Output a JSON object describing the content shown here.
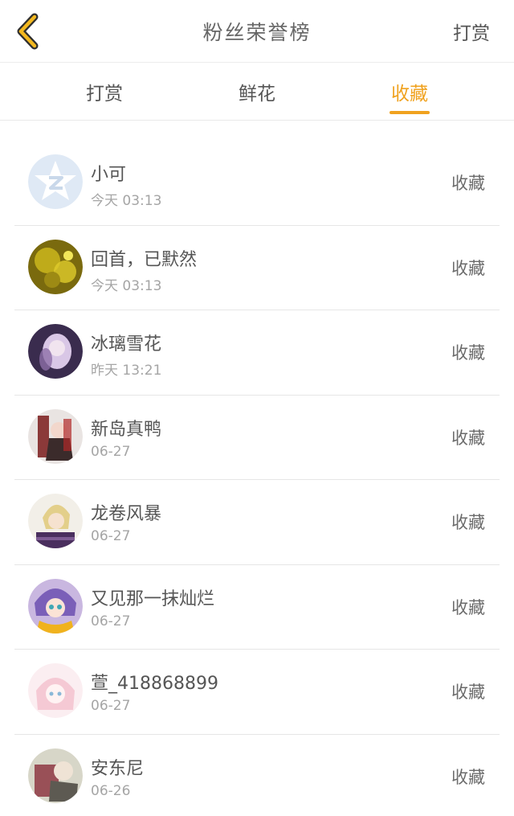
{
  "header": {
    "title": "粉丝荣誉榜",
    "action_label": "打赏",
    "back_icon": "chevron-left-icon",
    "accent_color": "#f0a21f"
  },
  "tabs": [
    {
      "label": "打赏",
      "active": false
    },
    {
      "label": "鲜花",
      "active": false
    },
    {
      "label": "收藏",
      "active": true
    }
  ],
  "fans": [
    {
      "name": "小可",
      "time": "今天 03:13",
      "action": "收藏",
      "avatar": "default-avatar"
    },
    {
      "name": "回首，已默然",
      "time": "今天 03:13",
      "action": "收藏",
      "avatar": "user-avatar"
    },
    {
      "name": "冰璃雪花",
      "time": "昨天 13:21",
      "action": "收藏",
      "avatar": "user-avatar"
    },
    {
      "name": "新岛真鸭",
      "time": "06-27",
      "action": "收藏",
      "avatar": "user-avatar"
    },
    {
      "name": "龙卷风暴",
      "time": "06-27",
      "action": "收藏",
      "avatar": "user-avatar"
    },
    {
      "name": "又见那一抹灿烂",
      "time": "06-27",
      "action": "收藏",
      "avatar": "user-avatar"
    },
    {
      "name": "萱_418868899",
      "time": "06-27",
      "action": "收藏",
      "avatar": "user-avatar"
    },
    {
      "name": "安东尼",
      "time": "06-26",
      "action": "收藏",
      "avatar": "user-avatar"
    }
  ]
}
